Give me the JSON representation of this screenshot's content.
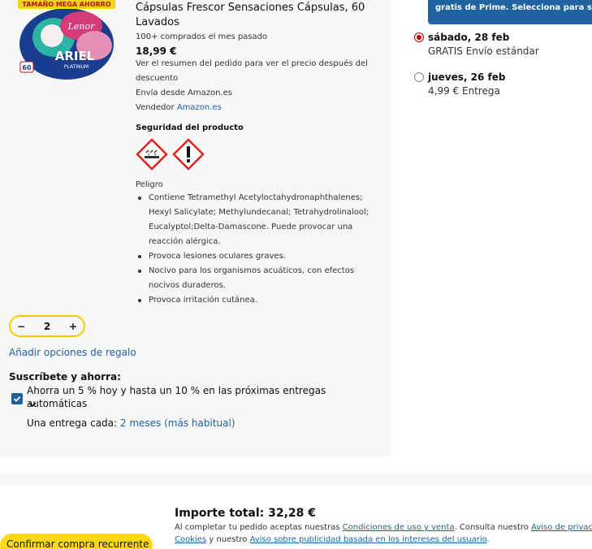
{
  "product": {
    "image_badge": "TAMAÑO MEGA AHORRO",
    "image_brand": "ARIEL",
    "image_subbrand": "PLATINUM",
    "image_count": "60",
    "image_lenor": "Lenor",
    "title": "Cápsulas Frescor Sensaciones Cápsulas, 60 Lavados",
    "purchased": "100+ comprados el mes pasado",
    "price": "18,99 €",
    "price_note": "Ver el resumen del pedido para ver el precio después del descuento",
    "ships_from": "Envía desde Amazon.es",
    "seller_label": "Vendedor",
    "seller_link": "Amazon.es",
    "safety_title": "Seguridad del producto",
    "danger_label": "Peligro",
    "hazards": [
      "Contiene Tetramethyl Acetyloctahydronaphthalenes; Hexyl Salicylate; Methylundecanal; Tetrahydrolinalool; Eucalyptol;Delta-Damascone. Puede provocar una reacción alérgica.",
      "Provoca lesiones oculares graves.",
      "Nocivo para los organismos acuáticos, con efectos nocivos duraderos.",
      "Provoca irritación cutánea."
    ]
  },
  "stepper": {
    "minus": "−",
    "quantity": "2",
    "plus": "+"
  },
  "gift_link": "Añadir opciones de regalo",
  "subscribe": {
    "title": "Suscríbete y ahorra:",
    "text": "Ahorra un 5 % hoy y hasta un 10 % en las próximas entregas automáticas",
    "freq_label": "Una entrega cada:",
    "freq_value": "2 meses (más habitual)",
    "checked": true
  },
  "prime_banner": "gratis de Prime. Selecciona para saber",
  "shipping": [
    {
      "date": "sábado, 28 feb",
      "option": "GRATIS Envío estándar",
      "selected": true
    },
    {
      "date": "jueves, 26 feb",
      "option": "4,99 € Entrega",
      "selected": false
    }
  ],
  "footer": {
    "total": "Importe total: 32,28 €",
    "legal_prefix": "Al completar tu pedido aceptas nuestras",
    "terms_link": "Condiciones de uso y venta",
    "legal_mid": ". Consulta nuestro",
    "privacy_link": "Aviso de privacidad",
    "cookies_link": "Cookies",
    "legal_and": "y nuestro",
    "ads_link": "Aviso sobre publicidad basada en los intereses del usuario",
    "legal_end": ".",
    "confirm_button": "Confirmar compra recurrente"
  },
  "colors": {
    "accent_blue": "#2162a1",
    "button_yellow": "#ffd814",
    "radio_red": "#c40000",
    "stepper_border": "#f7ca00"
  }
}
